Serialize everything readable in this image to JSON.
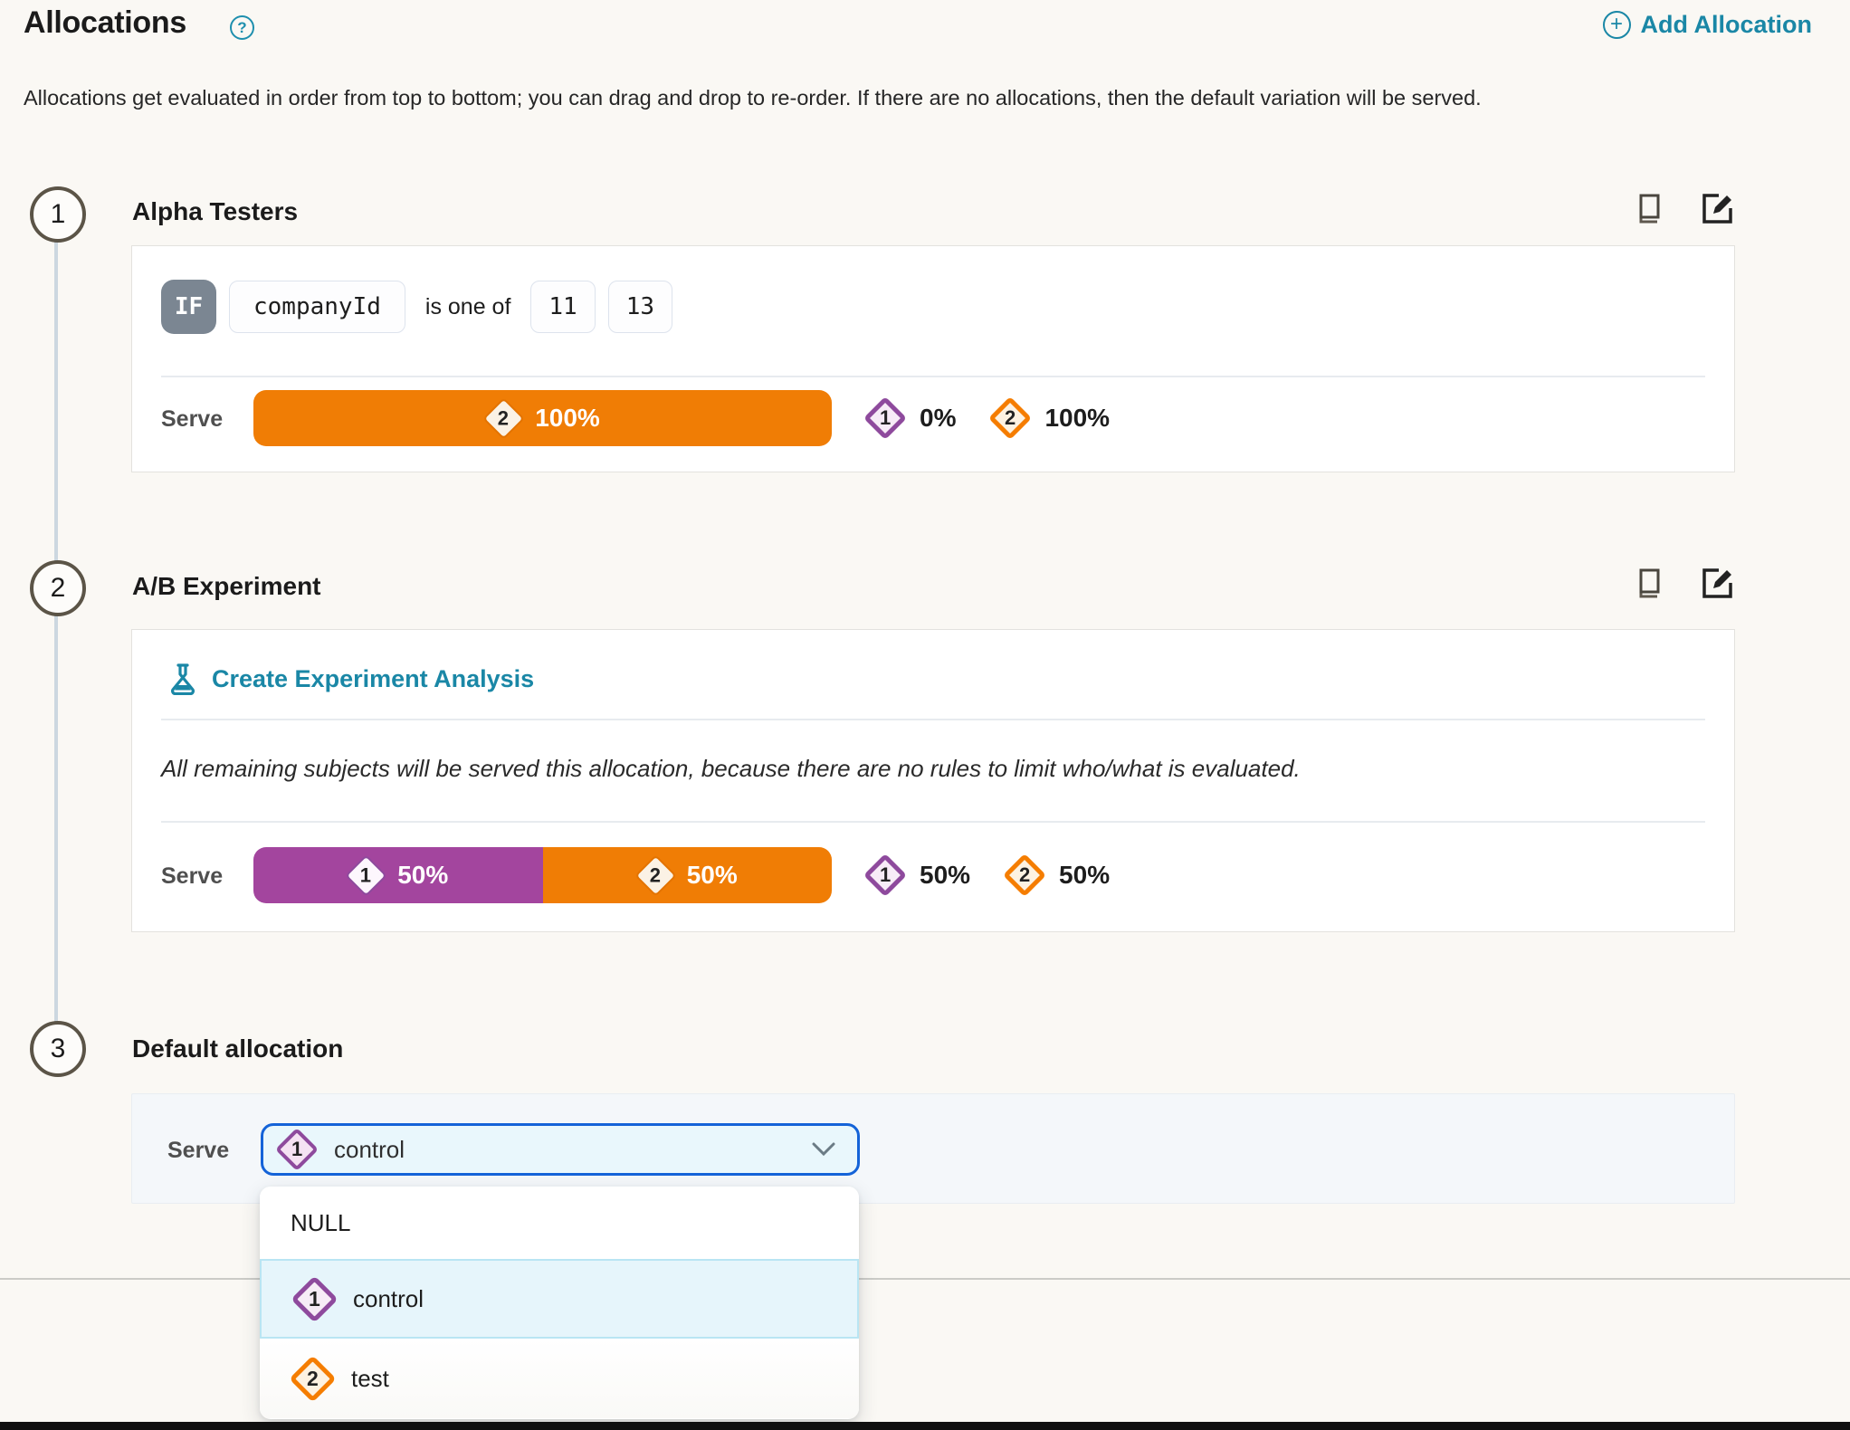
{
  "header": {
    "title": "Allocations",
    "help_icon_glyph": "?",
    "add_button_label": "Add Allocation",
    "add_button_icon_glyph": "+",
    "description": "Allocations get evaluated in order from top to bottom; you can drag and drop to re-order. If there are no allocations, then the default variation will be served."
  },
  "colors": {
    "teal_accent": "#1a87a6",
    "orange_variation": "#f07d05",
    "purple_variation": "#a3459e",
    "select_focus_border": "#1463d8",
    "page_background": "#faf8f4"
  },
  "allocations": [
    {
      "step": "1",
      "name": "Alpha Testers",
      "rule": {
        "keyword": "IF",
        "attribute": "companyId",
        "operator": "is one of",
        "values": [
          "11",
          "13"
        ]
      },
      "serve_label": "Serve",
      "bars": [
        {
          "variation": "2",
          "percent": "100%",
          "color": "orange",
          "width_pct": 100
        }
      ],
      "legend": [
        {
          "variation": "1",
          "percent": "0%",
          "color": "purple"
        },
        {
          "variation": "2",
          "percent": "100%",
          "color": "orange"
        }
      ]
    },
    {
      "step": "2",
      "name": "A/B Experiment",
      "analysis_link_label": "Create Experiment Analysis",
      "note": "All remaining subjects will be served this allocation, because there are no rules to limit who/what is evaluated.",
      "serve_label": "Serve",
      "bars": [
        {
          "variation": "1",
          "percent": "50%",
          "color": "purple",
          "width_pct": 50
        },
        {
          "variation": "2",
          "percent": "50%",
          "color": "orange",
          "width_pct": 50
        }
      ],
      "legend": [
        {
          "variation": "1",
          "percent": "50%",
          "color": "purple"
        },
        {
          "variation": "2",
          "percent": "50%",
          "color": "orange"
        }
      ]
    }
  ],
  "default_allocation": {
    "step": "3",
    "name": "Default allocation",
    "serve_label": "Serve",
    "selected_option": {
      "variation": "1",
      "label": "control",
      "color": "purple"
    },
    "dropdown_options": [
      {
        "label": "NULL"
      },
      {
        "variation": "1",
        "label": "control",
        "color": "purple",
        "selected": true
      },
      {
        "variation": "2",
        "label": "test",
        "color": "orange",
        "selected": false
      }
    ]
  }
}
